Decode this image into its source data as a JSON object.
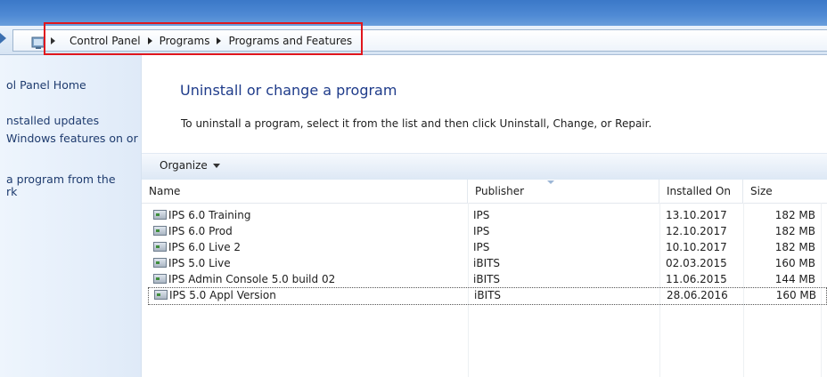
{
  "address_bar": {
    "breadcrumb": [
      "Control Panel",
      "Programs",
      "Programs and Features"
    ]
  },
  "left_pane": {
    "links": [
      "ol Panel Home",
      "nstalled updates",
      "Windows features on or",
      "a program from the",
      "rk"
    ]
  },
  "main": {
    "title": "Uninstall or change a program",
    "subtitle": "To uninstall a program, select it from the list and then click Uninstall, Change, or Repair."
  },
  "toolbar": {
    "organize_label": "Organize"
  },
  "table": {
    "columns": [
      "Name",
      "Publisher",
      "Installed On",
      "Size"
    ],
    "rows": [
      {
        "name": "IPS 6.0 Training",
        "publisher": "IPS",
        "installed_on": "13.10.2017",
        "size": "182 MB"
      },
      {
        "name": "IPS 6.0 Prod",
        "publisher": "IPS",
        "installed_on": "12.10.2017",
        "size": "182 MB"
      },
      {
        "name": "IPS 6.0 Live 2",
        "publisher": "IPS",
        "installed_on": "10.10.2017",
        "size": "182 MB"
      },
      {
        "name": "IPS 5.0 Live",
        "publisher": "iBITS",
        "installed_on": "02.03.2015",
        "size": "160 MB"
      },
      {
        "name": "IPS Admin Console 5.0 build 02",
        "publisher": "iBITS",
        "installed_on": "11.06.2015",
        "size": "144 MB"
      },
      {
        "name": "IPS 5.0 Appl Version",
        "publisher": "iBITS",
        "installed_on": "28.06.2016",
        "size": "160 MB"
      }
    ]
  },
  "colors": {
    "highlight_border": "#e0161d",
    "title_blue": "#1e3b8a",
    "link_blue": "#1e3b6e"
  }
}
